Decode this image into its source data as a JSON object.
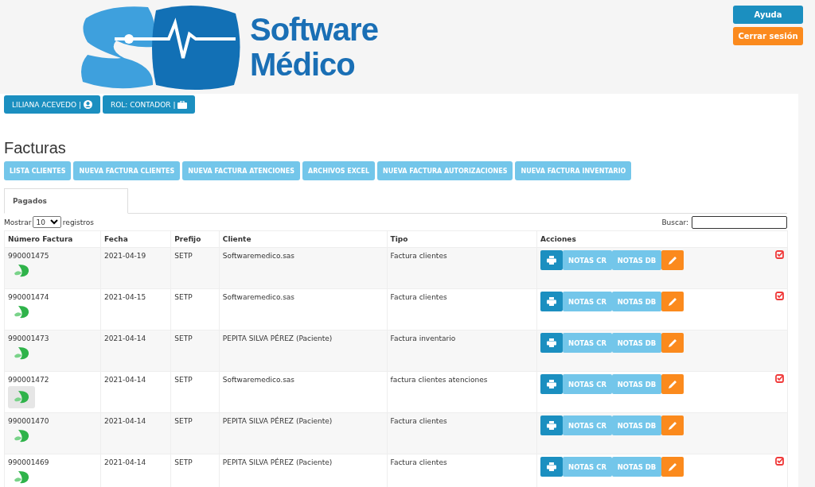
{
  "logo": {
    "line_1": "Software",
    "line_2": "Médico"
  },
  "header_buttons": [
    {
      "label": "Ayuda",
      "kind": "help"
    },
    {
      "label": "Cerrar sesión",
      "kind": "logout"
    }
  ],
  "user_bar": [
    {
      "label": "LILIANA ACEVEDO |",
      "kind": "user"
    },
    {
      "label": "ROL: CONTADOR |",
      "kind": "role"
    }
  ],
  "page_title": "Facturas",
  "nav_buttons": [
    "LISTA CLIENTES",
    "NUEVA FACTURA CLIENTES",
    "NUEVA FACTURA ATENCIONES",
    "ARCHIVOS EXCEL",
    "NUEVA FACTURA AUTORIZACIONES",
    "NUEVA FACTURA INVENTARIO"
  ],
  "tabs": [
    {
      "label": "Pagados",
      "selected": true
    }
  ],
  "length_control": {
    "before": "Mostrar",
    "value": "10",
    "after": "registros"
  },
  "search": {
    "label": "Buscar:"
  },
  "table": {
    "columns": [
      "Número Factura",
      "Fecha",
      "Prefijo",
      "Cliente",
      "Tipo",
      "Acciones"
    ],
    "rows": [
      {
        "number": "990001475",
        "date": "2021-04-19",
        "prefix": "SETP",
        "client": "Softwaremedico.sas",
        "type": "Factura clientes",
        "credit_label": "NOTAS CR",
        "debit_label": "NOTAS DB",
        "icon_highlighted": false,
        "checked": true
      },
      {
        "number": "990001474",
        "date": "2021-04-15",
        "prefix": "SETP",
        "client": "Softwaremedico.sas",
        "type": "Factura clientes",
        "credit_label": "NOTAS CR",
        "debit_label": "NOTAS DB",
        "icon_highlighted": false,
        "checked": true
      },
      {
        "number": "990001473",
        "date": "2021-04-14",
        "prefix": "SETP",
        "client": "PEPITA SILVA PÉREZ (Paciente)",
        "type": "Factura inventario",
        "credit_label": "NOTAS CR",
        "debit_label": "NOTAS DB",
        "icon_highlighted": false,
        "checked": false
      },
      {
        "number": "990001472",
        "date": "2021-04-14",
        "prefix": "SETP",
        "client": "Softwaremedico.sas",
        "type": "factura clientes atenciones",
        "credit_label": "NOTAS CR",
        "debit_label": "NOTAS DB",
        "icon_highlighted": true,
        "checked": true
      },
      {
        "number": "990001470",
        "date": "2021-04-14",
        "prefix": "SETP",
        "client": "PEPITA SILVA PÉREZ (Paciente)",
        "type": "Factura clientes",
        "credit_label": "NOTAS CR",
        "debit_label": "NOTAS DB",
        "icon_highlighted": false,
        "checked": false
      },
      {
        "number": "990001469",
        "date": "2021-04-14",
        "prefix": "SETP",
        "client": "PEPITA SILVA PÉREZ (Paciente)",
        "type": "Factura clientes",
        "credit_label": "NOTAS CR",
        "debit_label": "NOTAS DB",
        "icon_highlighted": false,
        "checked": true
      }
    ]
  }
}
